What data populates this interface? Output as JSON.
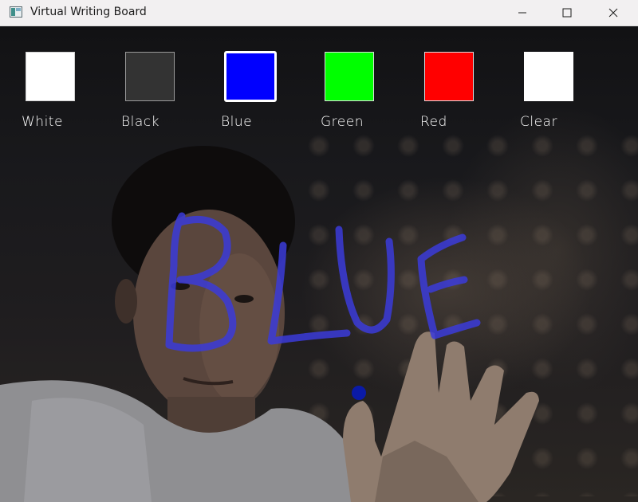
{
  "window": {
    "title": "Virtual Writing Board",
    "controls": {
      "minimize_icon": "minimize-icon",
      "maximize_icon": "maximize-icon",
      "close_icon": "close-icon"
    }
  },
  "palette": [
    {
      "label": "White",
      "color": "#ffffff",
      "selected": false
    },
    {
      "label": "Black",
      "color": "#333333",
      "selected": false
    },
    {
      "label": "Blue",
      "color": "#0000ff",
      "selected": true
    },
    {
      "label": "Green",
      "color": "#00ff00",
      "selected": false
    },
    {
      "label": "Red",
      "color": "#ff0000",
      "selected": false
    },
    {
      "label": "Clear",
      "color": "#ffffff",
      "selected": false
    }
  ],
  "drawing": {
    "stroke_color": "#3b3bd9"
  },
  "pointer": {
    "color": "#0a1aa6"
  }
}
